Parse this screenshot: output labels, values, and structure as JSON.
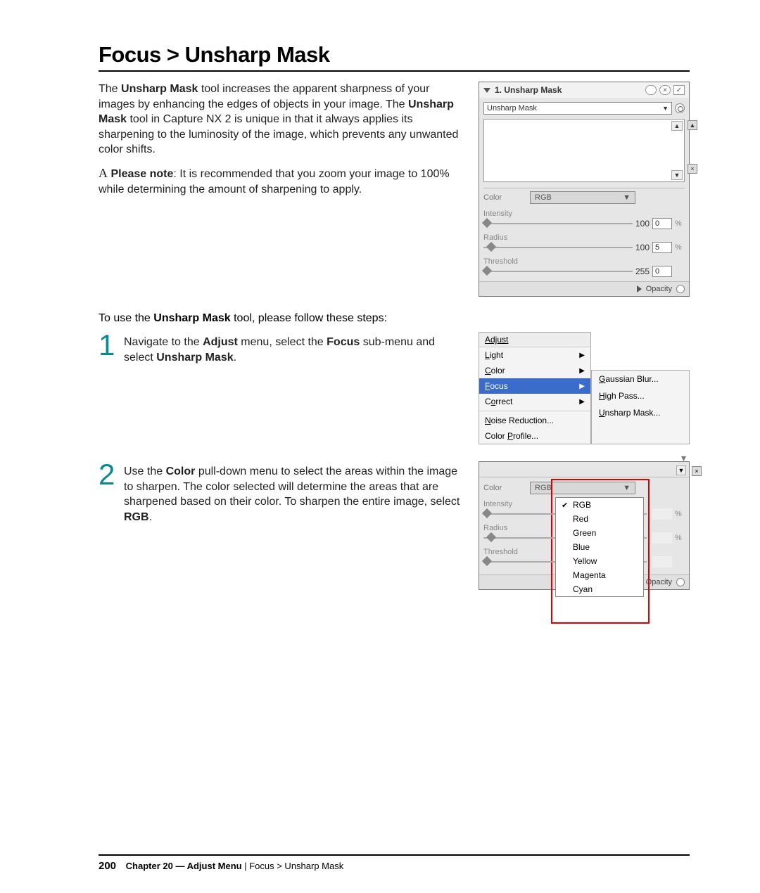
{
  "title": "Focus > Unsharp Mask",
  "intro": {
    "p1a": "The ",
    "p1b": "Unsharp Mask",
    "p1c": " tool increases the apparent sharpness of your images by enhancing the edges of objects in your image. The ",
    "p1d": "Unsharp Mask",
    "p1e": " tool in Capture NX 2 is unique in that it always applies its sharpening to the luminosity of the image, which prevents any unwanted color shifts."
  },
  "note": {
    "lead": "A",
    "label": "Please note",
    "body": ": It is recommended that you zoom your image to 100% while determining the amount of sharpening to apply."
  },
  "panel1": {
    "title": "1. Unsharp Mask",
    "drop_label": "Unsharp Mask",
    "color_label": "Color",
    "color_value": "RGB",
    "sliders": {
      "intensity": {
        "label": "Intensity",
        "max": "100",
        "value": "0",
        "unit": "%"
      },
      "radius": {
        "label": "Radius",
        "max": "100",
        "value": "5",
        "unit": "%"
      },
      "threshold": {
        "label": "Threshold",
        "max": "255",
        "value": "0",
        "unit": ""
      }
    },
    "opacity": "Opacity"
  },
  "steps_intro_a": "To use the ",
  "steps_intro_b": "Unsharp Mask",
  "steps_intro_c": " tool, please follow these steps:",
  "step1": {
    "num": "1",
    "a": "Navigate to the ",
    "b": "Adjust",
    "c": " menu, select the ",
    "d": "Focus",
    "e": " sub-menu and select ",
    "f": "Unsharp Mask",
    "g": "."
  },
  "menu": {
    "head": "Adjust",
    "items": [
      "Light",
      "Color",
      "Focus",
      "Correct",
      "Noise Reduction...",
      "Color Profile..."
    ],
    "sub": [
      "Gaussian Blur...",
      "High Pass...",
      "Unsharp Mask..."
    ]
  },
  "step2": {
    "num": "2",
    "a": "Use the ",
    "b": "Color",
    "c": " pull-down menu to select the areas within the image to sharpen. The color selected will determine the areas that are sharpened based on their color. To sharpen the entire image, select ",
    "d": "RGB",
    "e": "."
  },
  "panel2": {
    "color_label": "Color",
    "color_value": "RGB",
    "intensity": "Intensity",
    "radius": "Radius",
    "threshold": "Threshold",
    "percent": "%",
    "opacity": "Opacity",
    "options": [
      "RGB",
      "Red",
      "Green",
      "Blue",
      "Yellow",
      "Magenta",
      "Cyan"
    ]
  },
  "footer": {
    "page": "200",
    "chapter": "Chapter 20 — Adjust Menu",
    "sep": " | ",
    "crumb": "Focus > Unsharp Mask"
  }
}
